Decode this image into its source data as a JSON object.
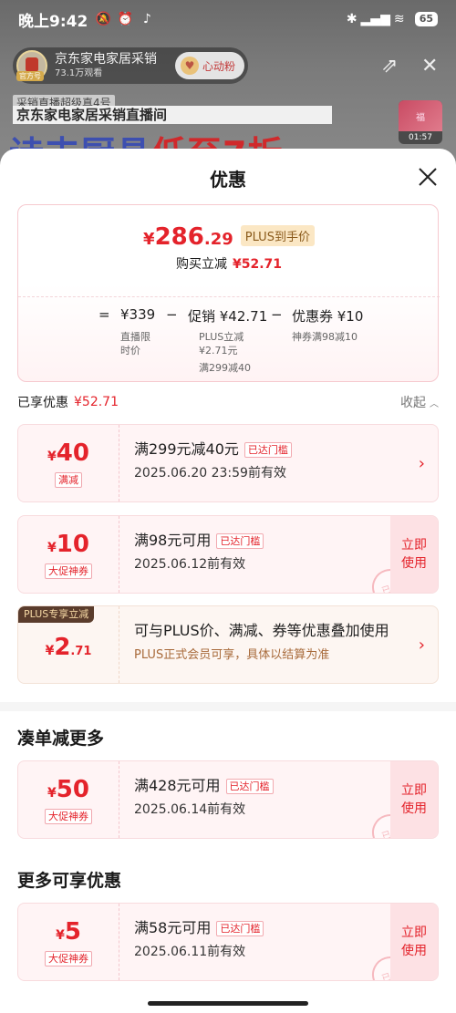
{
  "status_bar": {
    "time": "晚上9:42",
    "battery": "65"
  },
  "stream": {
    "host_name": "京东家电家居采销",
    "viewers": "73.1万观看",
    "host_badge": "官方号",
    "fan_button": "心动粉",
    "banner_small": "采销直播超级真4号",
    "banner_title": "京东家电家居采销直播间",
    "banner_big_a": "诗丰厨具",
    "banner_big_b": "低至7折",
    "mini_time": "01:57",
    "mini_label": "福"
  },
  "sheet": {
    "title": "优惠",
    "summary": {
      "yen": "¥",
      "price_int": "286",
      "price_dec": ".29",
      "plus_tag": "PLUS到手价",
      "instant_label": "购买立减",
      "instant_amount": "¥52.71",
      "eq": "=",
      "base_price": "¥339",
      "base_label_1": "直播限",
      "base_label_2": "时价",
      "minus1": "−",
      "promo": "促销 ¥42.71",
      "promo_sub1": "PLUS立减",
      "promo_sub2": "¥2.71元",
      "promo_sub3": "满299减40",
      "minus2": "−",
      "coupon": "优惠券 ¥10",
      "coupon_sub": "神券满98减10"
    },
    "enjoyed_label": "已享优惠",
    "enjoyed_amount": "¥52.71",
    "collapse_label": "收起",
    "coupons": [
      {
        "yen": "¥",
        "amount": "40",
        "type": "满减",
        "title": "满299元减40元",
        "reached": "已达门槛",
        "date": "2025.06.20 23:59前有效"
      },
      {
        "yen": "¥",
        "amount": "10",
        "type": "大促神券",
        "title": "满98元可用",
        "reached": "已达门槛",
        "date": "2025.06.12前有效",
        "use_1": "立即",
        "use_2": "使用",
        "stamp": "已领"
      },
      {
        "ribbon": "PLUS专享立减",
        "yen": "¥",
        "amount": "2",
        "amount_dec": ".71",
        "title": "可与PLUS价、满减、券等优惠叠加使用",
        "date": "PLUS正式会员可享，具体以结算为准"
      }
    ],
    "section_more": "凑单减更多",
    "more_coupons": [
      {
        "yen": "¥",
        "amount": "50",
        "type": "大促神券",
        "title": "满428元可用",
        "reached": "已达门槛",
        "date": "2025.06.14前有效",
        "use_1": "立即",
        "use_2": "使用",
        "stamp": "已领"
      }
    ],
    "section_extra": "更多可享优惠",
    "extra_coupons": [
      {
        "yen": "¥",
        "amount": "5",
        "type": "大促神券",
        "title": "满58元可用",
        "reached": "已达门槛",
        "date": "2025.06.11前有效",
        "use_1": "立即",
        "use_2": "使用",
        "stamp": "已领"
      }
    ]
  },
  "colors": {
    "accent_red": "#e4232b",
    "coupon_bg": "#fff4f5",
    "plus_brown": "#5a3c2c"
  }
}
